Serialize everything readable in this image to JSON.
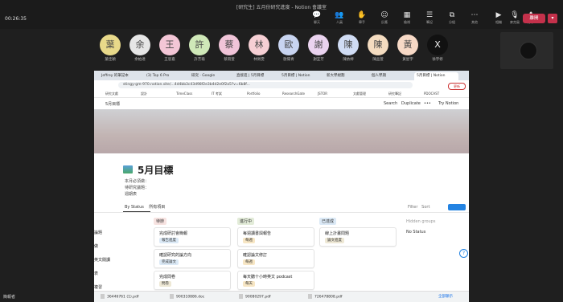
{
  "meeting": {
    "title": "[研究生] 五月份研究進度 - Notion 會議室",
    "timer": "00:26:35",
    "toolbar": [
      {
        "icon": "chat-icon",
        "glyph": "💬",
        "label": "聊天"
      },
      {
        "icon": "people-icon",
        "glyph": "👥",
        "label": "人員"
      },
      {
        "icon": "raise-hand-icon",
        "glyph": "✋",
        "label": "舉手"
      },
      {
        "icon": "reactions-icon",
        "glyph": "☺",
        "label": "反應"
      },
      {
        "icon": "view-icon",
        "glyph": "▦",
        "label": "檢視"
      },
      {
        "icon": "notes-icon",
        "glyph": "☰",
        "label": "筆記"
      },
      {
        "icon": "rooms-icon",
        "glyph": "⧉",
        "label": "分組"
      },
      {
        "icon": "more-icon",
        "glyph": "⋯",
        "label": "其他"
      },
      {
        "icon": "camera-icon",
        "glyph": "▶",
        "label": "相機"
      },
      {
        "icon": "mic-icon",
        "glyph": "🎙",
        "label": "麥克風"
      },
      {
        "icon": "share-icon",
        "glyph": "⬆",
        "label": "分享"
      }
    ],
    "leave_label": "離開",
    "participants": [
      {
        "initial": "葉",
        "name": "葉佳穎",
        "color": "#e8d98a"
      },
      {
        "initial": "余",
        "name": "余柏達",
        "color": "#e6e6e6"
      },
      {
        "initial": "王",
        "name": "王思嘉",
        "color": "#f3c6d6"
      },
      {
        "initial": "許",
        "name": "許芳瑜",
        "color": "#cfe8b8"
      },
      {
        "initial": "蔡",
        "name": "蔡雨萱",
        "color": "#f0c4d8"
      },
      {
        "initial": "林",
        "name": "林佩雯",
        "color": "#f6cfd4"
      },
      {
        "initial": "歐",
        "name": "歐陽青",
        "color": "#c8d4f0"
      },
      {
        "initial": "謝",
        "name": "謝宜芳",
        "color": "#ead3ef"
      },
      {
        "initial": "陳",
        "name": "陳依婷",
        "color": "#d0dcf4"
      },
      {
        "initial": "陳",
        "name": "陳品萱",
        "color": "#f4dcc0"
      },
      {
        "initial": "黃",
        "name": "黃星宇",
        "color": "#f7d9c6"
      },
      {
        "initial": "X",
        "name": "徐宇修",
        "color": "#111111"
      }
    ],
    "presenter": "簡報者"
  },
  "browser": {
    "tabs": [
      "Jeffrey 的筆記本",
      "(3) Top 6 Pro",
      "研究 · Google",
      "直接進 | 5月目標",
      "5月目標 | Notion",
      "新大學規劃",
      "個人學期",
      "5月目標 | Notion"
    ],
    "url": "stingy-gm-970.notion.site/...4d4bb3c43d98f2e3b4d2e0f2a5?v=6b8f...",
    "update_label": "更新",
    "bookmarks": [
      "研究文獻",
      "設計",
      "TimeClass",
      "IT 考試",
      "Portfolio",
      "ResearchGate",
      "JSTOR",
      "文獻管理",
      "研究筆記",
      "PDOCAST"
    ]
  },
  "notion": {
    "breadcrumb": "5月目標",
    "search": "Search",
    "duplicate": "Duplicate",
    "more": "•••",
    "try": "Try Notion",
    "title": "5月目標",
    "properties": [
      "本月必須做：",
      "待研究議題：",
      "週期表"
    ],
    "view_tab": "By Status",
    "view_tab2": "所有項目",
    "filter": "Filter",
    "sort": "Sort",
    "groups": [
      {
        "label": "待辦",
        "color": "#f7e3e1"
      },
      {
        "label": "進行中",
        "color": "#e3ecd9"
      },
      {
        "label": "已達成",
        "color": "#dbe9f6"
      }
    ],
    "cards": [
      {
        "title": "完成研討會簡報",
        "tag": "報告進度",
        "tagcolor": "#dbe9f6",
        "col": 0,
        "row": 0
      },
      {
        "title": "確認研究的論方向",
        "tag": "完成論文",
        "tagcolor": "#dbe9f6",
        "col": 0,
        "row": 1
      },
      {
        "title": "完成問卷",
        "tag": "問卷",
        "tagcolor": "#eee8d5",
        "col": 0,
        "row": 2
      },
      {
        "title": "每週讀書與報告",
        "tag": "每週",
        "tagcolor": "#f7e6c4",
        "col": 1,
        "row": 0
      },
      {
        "title": "確認論文修訂",
        "tag": "每週",
        "tagcolor": "#f7e6c4",
        "col": 1,
        "row": 1
      },
      {
        "title": "每天聽十小時英文 podcast",
        "tag": "每天",
        "tagcolor": "#f7e6c4",
        "col": 1,
        "row": 2
      },
      {
        "title": "線上計畫問題",
        "tag": "論文進度",
        "tagcolor": "#eee8d5",
        "col": 2,
        "row": 0
      }
    ],
    "left_rows": [
      "論題",
      "做",
      "英文閱讀",
      "表",
      "複習"
    ],
    "hidden_groups": "Hidden groups",
    "no_status": "No Status",
    "help": "?"
  },
  "downloads": [
    "36446761 (1).pdf",
    "900310886.doc",
    "90080297.pdf",
    "726478808.pdf"
  ],
  "show_all": "全部顯示"
}
